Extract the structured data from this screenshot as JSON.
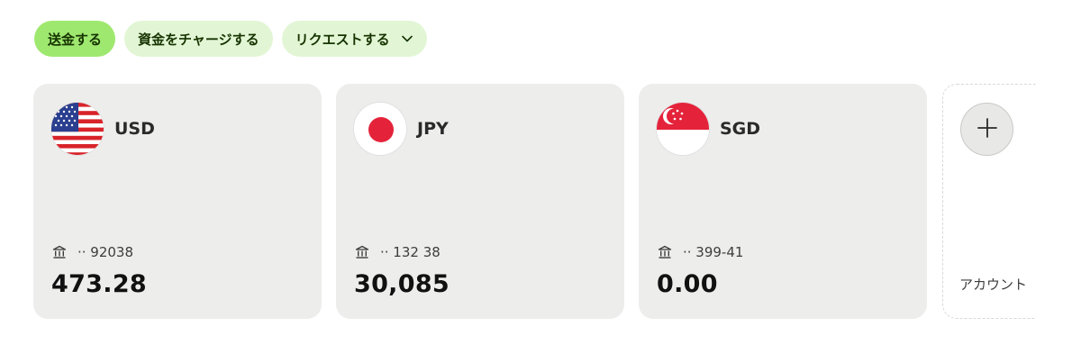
{
  "actions": {
    "send_label": "送金する",
    "add_money_label": "資金をチャージする",
    "request_label": "リクエストする"
  },
  "accounts": [
    {
      "currency": "USD",
      "account_ref": "·· 92038",
      "balance": "473.28",
      "flag_icon": "us-flag-icon"
    },
    {
      "currency": "JPY",
      "account_ref": "·· 132 38",
      "balance": "30,085",
      "flag_icon": "jp-flag-icon"
    },
    {
      "currency": "SGD",
      "account_ref": "·· 399-41",
      "balance": "0.00",
      "flag_icon": "sg-flag-icon"
    }
  ],
  "add_account": {
    "label": "アカウント"
  },
  "colors": {
    "primary_button": "#9fe870",
    "secondary_button": "#e2f6d5",
    "button_text": "#163300",
    "card_background": "#edeeec"
  }
}
